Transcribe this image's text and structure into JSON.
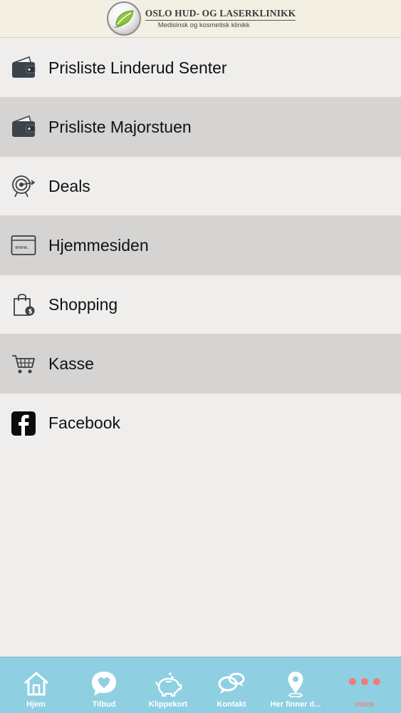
{
  "header": {
    "logo_title": "OSLO HUD- OG LASERKLINIKK",
    "logo_subtitle": "Medisinsk  og kosmetisk klinikk"
  },
  "menu": {
    "items": [
      {
        "label": "Prisliste Linderud Senter",
        "icon": "wallet-icon"
      },
      {
        "label": "Prisliste Majorstuen",
        "icon": "wallet-icon"
      },
      {
        "label": "Deals",
        "icon": "target-icon"
      },
      {
        "label": "Hjemmesiden",
        "icon": "browser-window-icon"
      },
      {
        "label": "Shopping",
        "icon": "shopping-bag-icon"
      },
      {
        "label": "Kasse",
        "icon": "cart-icon"
      },
      {
        "label": "Facebook",
        "icon": "facebook-icon"
      }
    ]
  },
  "tabbar": {
    "tabs": [
      {
        "label": "Hjem",
        "icon": "home-icon"
      },
      {
        "label": "Tilbud",
        "icon": "heart-bubble-icon"
      },
      {
        "label": "Klippekort",
        "icon": "piggy-bank-icon"
      },
      {
        "label": "Kontakt",
        "icon": "chat-bubbles-icon"
      },
      {
        "label": "Her finner d...",
        "icon": "map-pin-icon"
      },
      {
        "label": "more",
        "icon": "more-dots-icon"
      }
    ],
    "active_index": 5
  },
  "colors": {
    "header_bg": "#f3efe2",
    "row_light": "#efeeec",
    "row_dark": "#d5d4d3",
    "tabbar_bg": "#8fcfe2",
    "active_tab": "#f08383"
  }
}
